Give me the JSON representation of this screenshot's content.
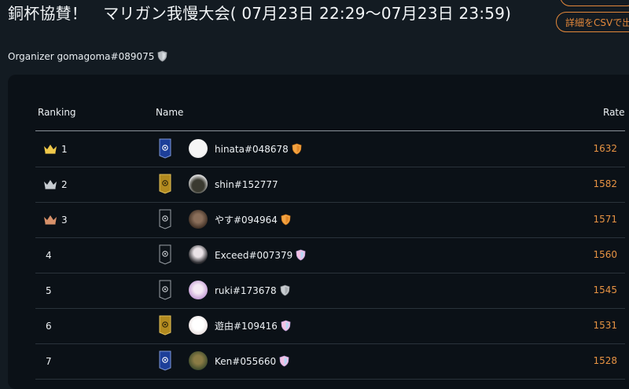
{
  "page": {
    "title": "銅杯協賛！　マリガン我慢大会( 07月23日 22:29～07月23日 23:59)",
    "csv_label": "詳細をCSVで出力",
    "organizer": "Organizer gomagoma#089075"
  },
  "table": {
    "headers": {
      "ranking": "Ranking",
      "name": "Name",
      "rate": "Rate"
    },
    "rows": [
      {
        "rank": "1",
        "crown": "gold",
        "banner": "blue",
        "name": "hinata#048678",
        "badge": "orange",
        "rate": "1632"
      },
      {
        "rank": "2",
        "crown": "silver",
        "banner": "gold",
        "name": "shin#152777",
        "badge": "none",
        "rate": "1582"
      },
      {
        "rank": "3",
        "crown": "bronze",
        "banner": "dark",
        "name": "やす#094964",
        "badge": "orange",
        "rate": "1571"
      },
      {
        "rank": "4",
        "crown": "none",
        "banner": "dark",
        "name": "Exceed#007379",
        "badge": "rainbow",
        "rate": "1560"
      },
      {
        "rank": "5",
        "crown": "none",
        "banner": "dark",
        "name": "ruki#173678",
        "badge": "silver",
        "rate": "1545"
      },
      {
        "rank": "6",
        "crown": "none",
        "banner": "gold",
        "name": "遊由#109416",
        "badge": "rainbow",
        "rate": "1531"
      },
      {
        "rank": "7",
        "crown": "none",
        "banner": "blue",
        "name": "Ken#055660",
        "badge": "rainbow",
        "rate": "1528"
      }
    ]
  },
  "colors": {
    "accent": "#e79343",
    "background": "#131b22",
    "panel": "#0b1117",
    "crown_gold": "#f0c84a",
    "crown_silver": "#c7ccd1",
    "crown_bronze": "#d7916a"
  }
}
